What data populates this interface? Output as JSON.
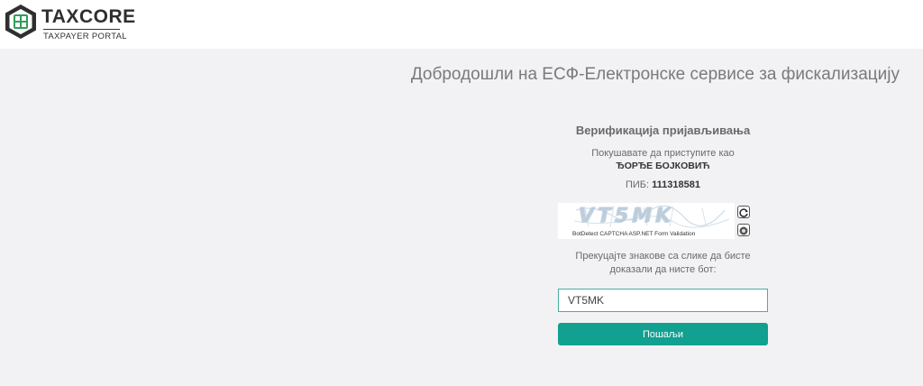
{
  "header": {
    "logo_title": "TAXCORE",
    "logo_subtitle": "TAXPAYER PORTAL"
  },
  "welcome_text": "Добродошли на ЕСФ-Електронске сервисе за фискализацију",
  "verification": {
    "title": "Верификација пријављивања",
    "attempt_text": "Покушавате да приступите као",
    "user_name": "ЂОРЂЕ БОЈКОВИЋ",
    "pib_label": "ПИБ:",
    "pib_value": "111318581"
  },
  "captcha": {
    "image_text": "VT5MK",
    "caption": "BotDetect CAPTCHA ASP.NET Form Validation",
    "reload_icon": "reload-icon",
    "sound_icon": "sound-icon"
  },
  "prompt_text": "Прекуцајте знакове са слике да бисте доказали да нисте бот:",
  "code_input": {
    "value": "VT5MK"
  },
  "submit_label": "Пошаљи",
  "colors": {
    "accent": "#12a090",
    "input_border": "#4aaea0",
    "background": "#f2f2f4"
  }
}
